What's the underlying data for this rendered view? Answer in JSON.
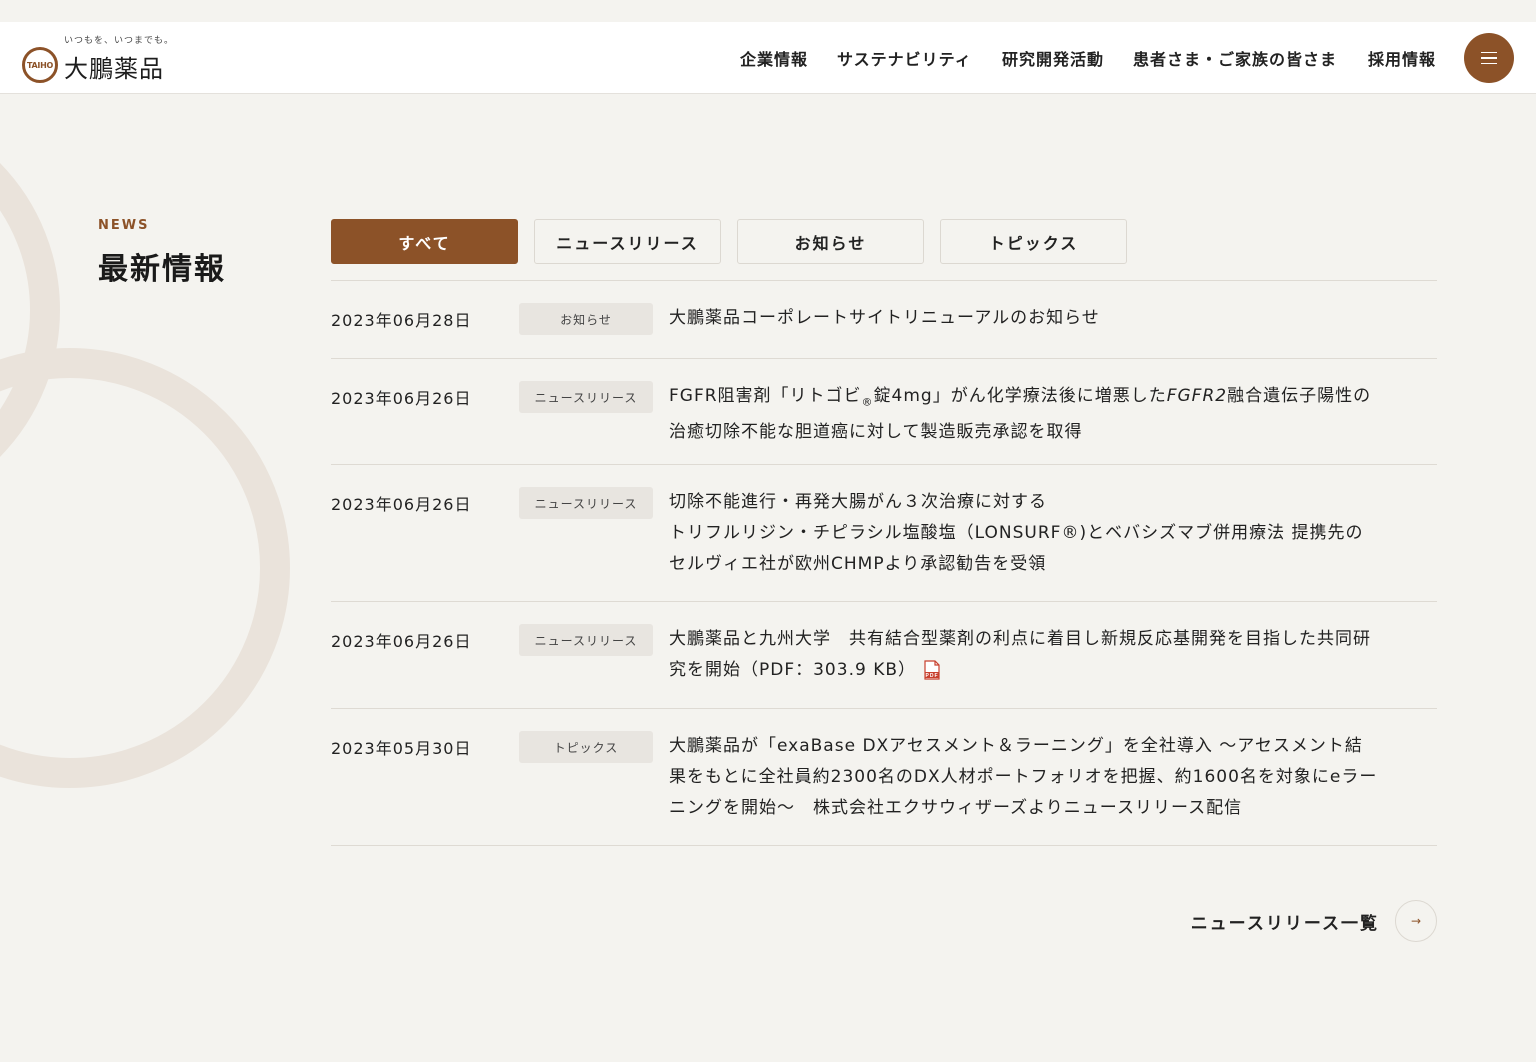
{
  "colors": {
    "accent": "#8c5228",
    "background": "#f4f3ef",
    "tag_bg": "#e8e5e0",
    "ring": "#eae3db"
  },
  "logo": {
    "tagline": "いつもを、いつまでも。",
    "mark": "TAIHO",
    "name": "大鵬薬品"
  },
  "nav": {
    "items": [
      {
        "label": "企業情報"
      },
      {
        "label": "サステナビリティ"
      },
      {
        "label": "研究開発活動"
      },
      {
        "label": "患者さま・ご家族の皆さま"
      },
      {
        "label": "採用情報"
      }
    ],
    "menu_icon": "hamburger-icon"
  },
  "section": {
    "label": "NEWS",
    "title": "最新情報"
  },
  "tabs": [
    {
      "label": "すべて",
      "active": true
    },
    {
      "label": "ニュースリリース",
      "active": false
    },
    {
      "label": "お知らせ",
      "active": false
    },
    {
      "label": "トピックス",
      "active": false
    }
  ],
  "news": [
    {
      "date": "2023年06月28日",
      "category": "お知らせ",
      "title": "大鵬薬品コーポレートサイトリニューアルのお知らせ"
    },
    {
      "date": "2023年06月26日",
      "category": "ニュースリリース",
      "title_parts": [
        "FGFR阻害剤「リトゴビ",
        "®",
        "錠4mg」がん化学療法後に増悪した",
        "FGFR2",
        "融合遺伝子陽性の治癒切除不能な胆道癌に対して製造販売承認を取得"
      ]
    },
    {
      "date": "2023年06月26日",
      "category": "ニュースリリース",
      "title_lines": [
        "切除不能進行・再発大腸がん３次治療に対する",
        "トリフルリジン・チピラシル塩酸塩（LONSURF®)とベバシズマブ併用療法 提携先のセルヴィエ社が欧州CHMPより承認勧告を受領"
      ]
    },
    {
      "date": "2023年06月26日",
      "category": "ニュースリリース",
      "title": "大鵬薬品と九州大学　共有結合型薬剤の利点に着目し新規反応基開発を目指した共同研究を開始（PDF：303.9 KB）",
      "icon": "pdf-icon",
      "icon_label": "PDF"
    },
    {
      "date": "2023年05月30日",
      "category": "トピックス",
      "title": "大鵬薬品が「exaBase DXアセスメント＆ラーニング」を全社導入 ～アセスメント結果をもとに全社員約2300名のDX人材ポートフォリオを把握、約1600名を対象にeラーニングを開始～　株式会社エクサウィザーズよりニュースリリース配信"
    }
  ],
  "more": {
    "label": "ニュースリリース一覧",
    "icon": "arrow-right-icon",
    "arrow": "→"
  }
}
